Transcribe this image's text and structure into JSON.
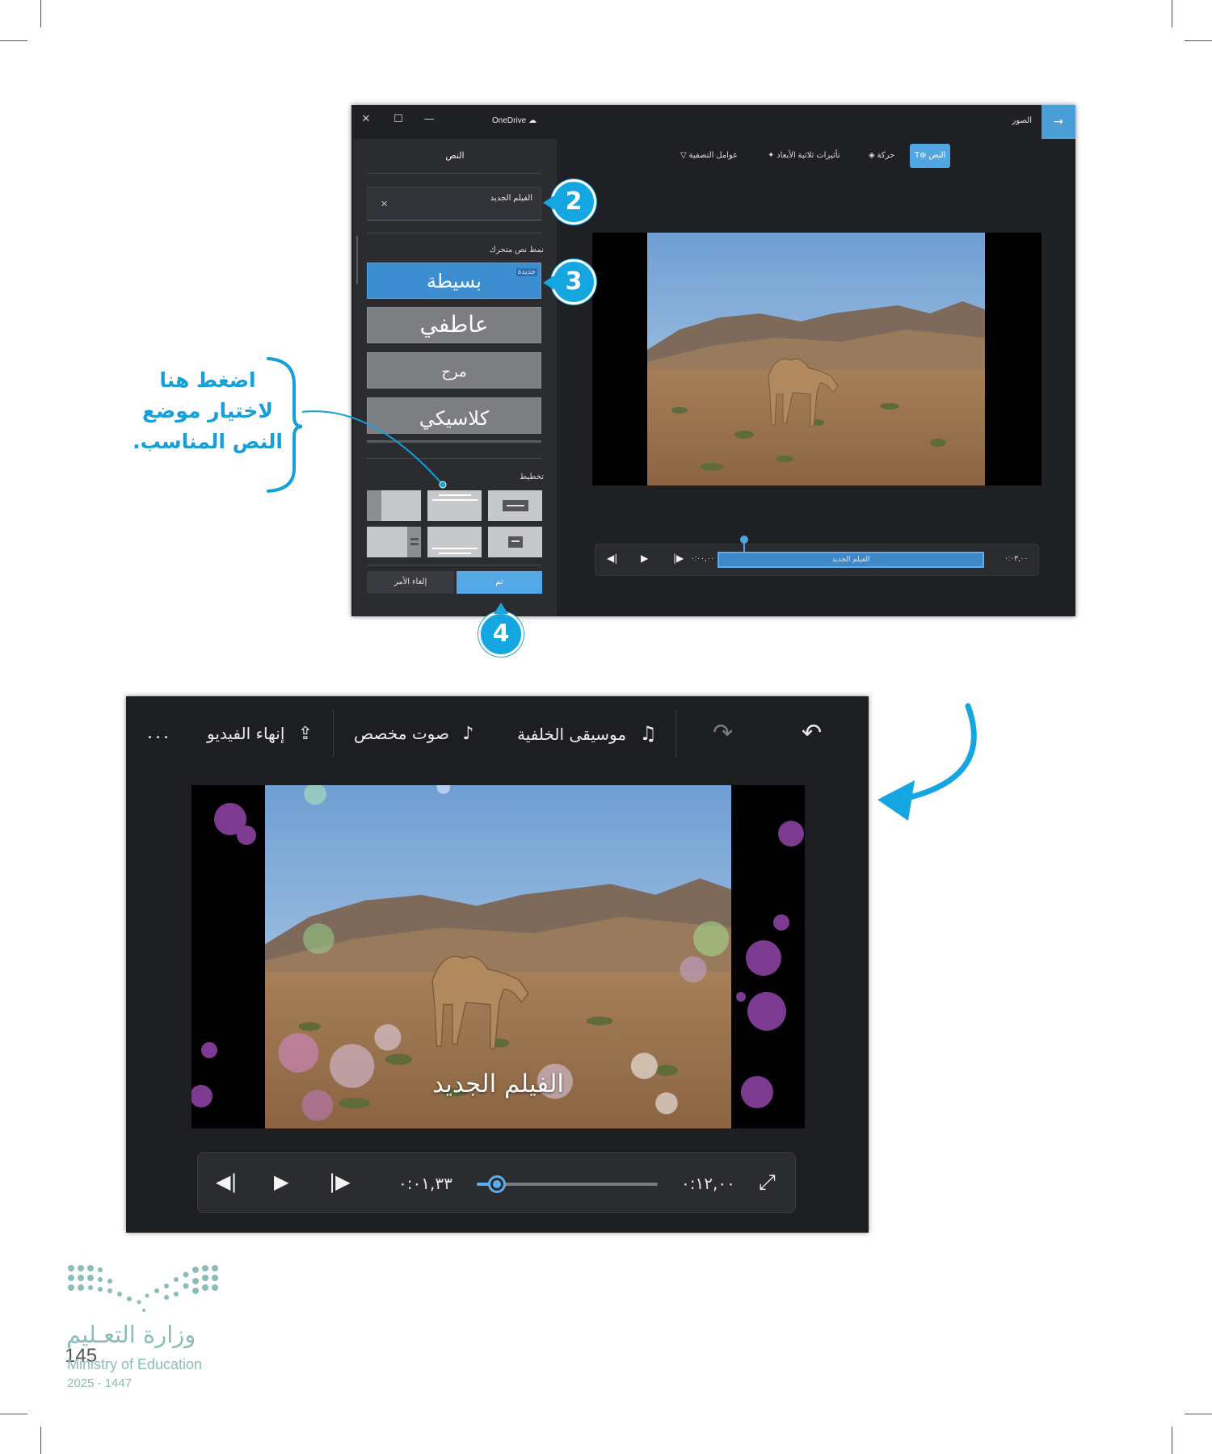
{
  "window1": {
    "app": "OneDrive",
    "photos": "الصور",
    "panel": {
      "title": "النص",
      "text_value": "الفيلم الجديد",
      "animated_style_label": "نمط نص متحرك",
      "new_badge": "جديدة",
      "styles": [
        "بسيطة",
        "عاطفي",
        "مرح",
        "كلاسيكي"
      ],
      "layout_label": "تخطيط",
      "cancel": "إلغاء الأمر",
      "done": "تم"
    },
    "tools": {
      "text": "النص",
      "motion": "حركة",
      "effects_3d": "تأثيرات ثلاثية الأبعاد",
      "filters": "عوامل التصفية"
    },
    "timeline": {
      "clip_text": "الفيلم الجديد",
      "start_time": "٠:٠٠,٠٠",
      "end_time": "٠:٠٣,٠٠"
    }
  },
  "callouts": {
    "step2": "2",
    "step3": "3",
    "step4": "4",
    "note_lines": [
      "اضغط هنا",
      "لاختيار موضع",
      "النص المناسب."
    ]
  },
  "window2": {
    "toolbar": {
      "background_music": "موسيقى الخلفية",
      "custom_audio": "صوت مخصص",
      "finish_video": "إنهاء الفيديو",
      "more": "..."
    },
    "caption": "الفيلم الجديد",
    "current_time": "٠:٠١,٣٣",
    "total_time": "٠:١٢,٠٠",
    "progress": 0.11
  },
  "footer": {
    "ministry_ar": "وزارة التعـليم",
    "ministry_en": "Ministry of Education",
    "year": "2025 - 1447",
    "page_number": "145"
  },
  "colors": {
    "accent": "#4fa6e2",
    "callout": "#14a6e0",
    "panel_bg": "#2b2c30"
  }
}
